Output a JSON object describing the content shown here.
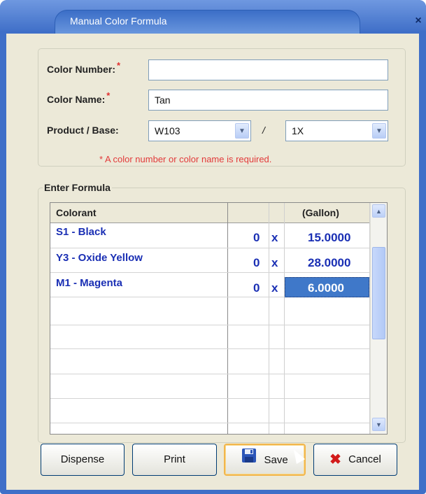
{
  "window": {
    "title": "Manual Color Formula",
    "close_glyph": "×"
  },
  "form": {
    "color_number_label": "Color Number:",
    "color_number_value": "",
    "color_name_label": "Color Name:",
    "color_name_value": "Tan",
    "required_marker": "*",
    "product_base_label": "Product / Base:",
    "product_value": "W103",
    "separator": "/",
    "base_value": "1X",
    "hint": "* A color number or color name is required."
  },
  "formula": {
    "group_label": "Enter Formula",
    "col_colorant": "Colorant",
    "col_unit": "(Gallon)",
    "rows": [
      {
        "colorant": "S1 - Black",
        "qty": "0",
        "x": "x",
        "amount": "15.0000"
      },
      {
        "colorant": "Y3 - Oxide Yellow",
        "qty": "0",
        "x": "x",
        "amount": "28.0000"
      },
      {
        "colorant": "M1 - Magenta",
        "qty": "0",
        "x": "x",
        "amount": "6.0000"
      }
    ]
  },
  "buttons": {
    "dispense": "Dispense",
    "print": "Print",
    "save": "Save",
    "cancel": "Cancel"
  },
  "icons": {
    "save": "floppy-disk-icon",
    "cancel": "red-x-icon",
    "dropdown": "chevron-down-icon"
  },
  "colors": {
    "title_bar": "#3f6fc8",
    "required": "#e03030",
    "grid_text": "#1a2fb4",
    "selection": "#3f78c9"
  }
}
